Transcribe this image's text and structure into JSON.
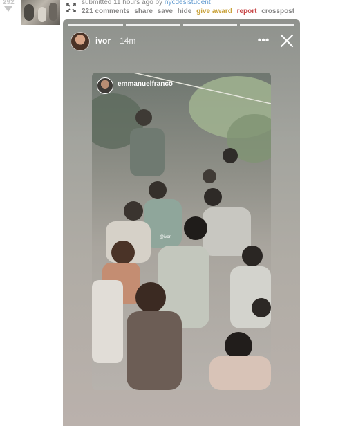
{
  "post": {
    "score": "292",
    "submitted_prefix": "submitted 11 hours ago by",
    "author": "nycdesistudent",
    "actions": [
      "221 comments",
      "share",
      "save",
      "hide",
      "give award",
      "report",
      "crosspost"
    ]
  },
  "story": {
    "username": "ivor",
    "time_ago": "14m",
    "progress_segments": 4,
    "embedded": {
      "username": "emmanuelfranco",
      "tag": "@ivor"
    }
  },
  "colors": {
    "author_link": "#5f99cf",
    "award": "#c9a23a",
    "report": "#c84a4a",
    "muted": "#888888"
  }
}
